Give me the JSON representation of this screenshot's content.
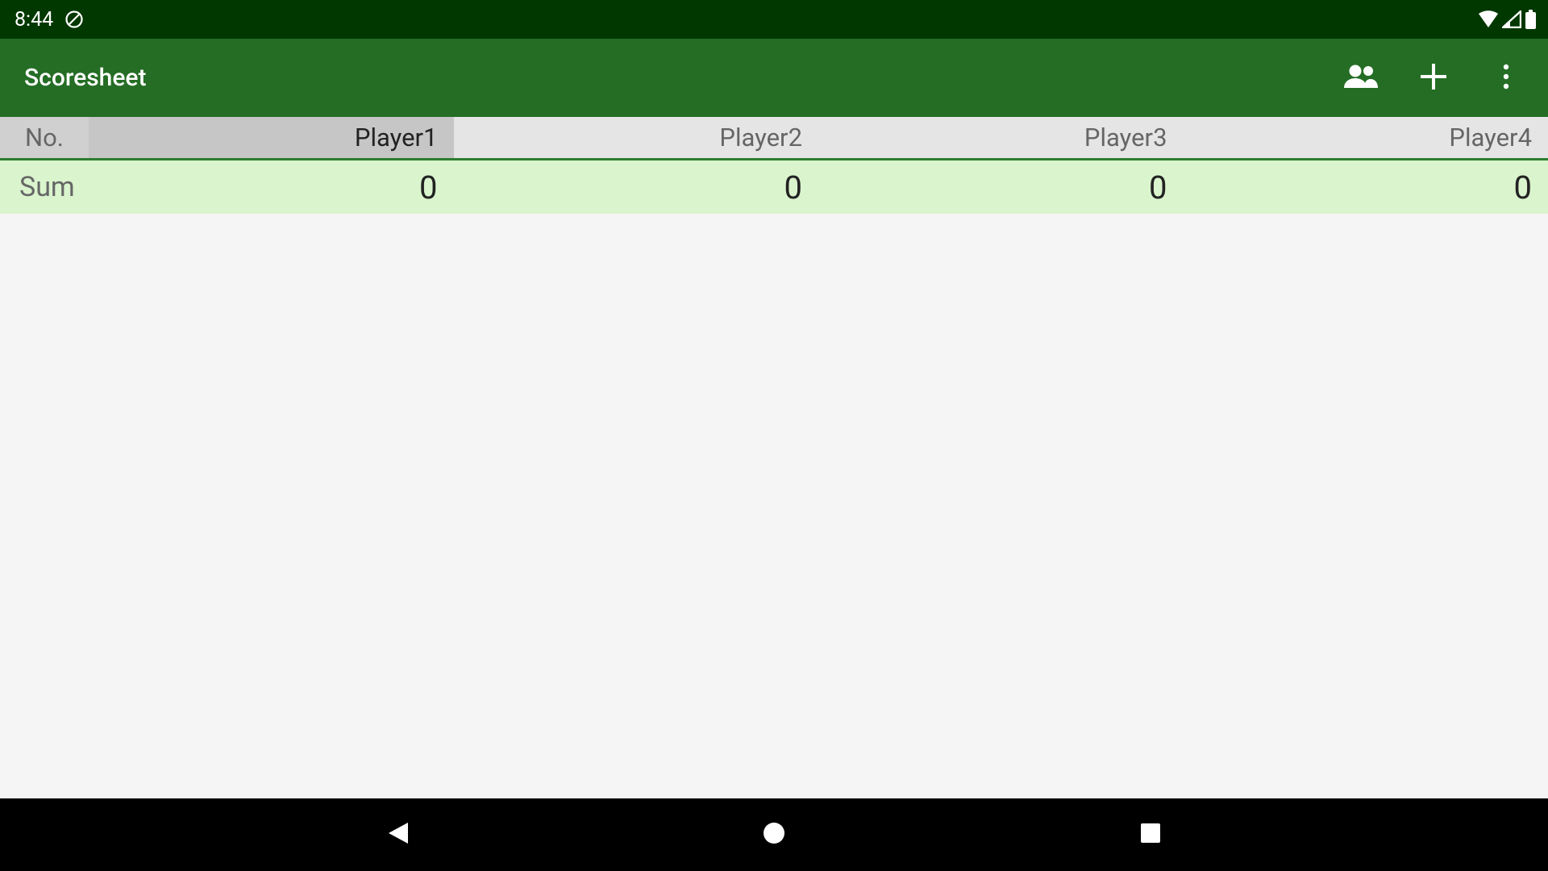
{
  "status_bar": {
    "time": "8:44"
  },
  "app_bar": {
    "title": "Scoresheet"
  },
  "header": {
    "no_label": "No.",
    "players": [
      "Player1",
      "Player2",
      "Player3",
      "Player4"
    ],
    "active_index": 0
  },
  "sum": {
    "label": "Sum",
    "values": [
      "0",
      "0",
      "0",
      "0"
    ]
  }
}
